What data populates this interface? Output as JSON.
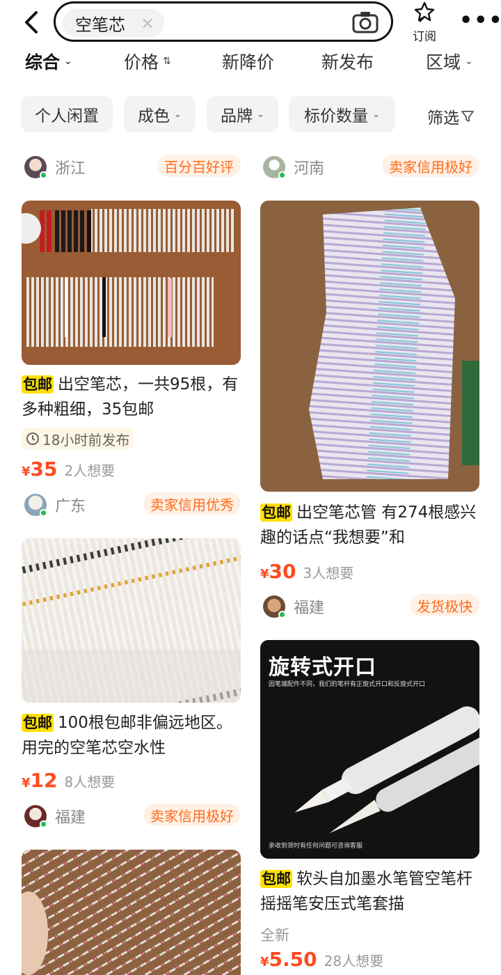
{
  "search": {
    "query": "空笔芯",
    "clear_glyph": "×"
  },
  "header": {
    "subscribe_label": "订阅"
  },
  "sort": [
    {
      "label": "综合",
      "caret": "⌄"
    },
    {
      "label": "价格",
      "caret": "⇅"
    },
    {
      "label": "新降价"
    },
    {
      "label": "新发布"
    },
    {
      "label": "区域",
      "caret": "⌄"
    }
  ],
  "filters": [
    {
      "label": "个人闲置"
    },
    {
      "label": "成色",
      "caret": "⌄"
    },
    {
      "label": "品牌",
      "caret": "⌄"
    },
    {
      "label": "标价数量",
      "caret": "⌄"
    }
  ],
  "filter_button": {
    "label": "筛选",
    "icon": "funnel-icon"
  },
  "items": [
    {
      "region": "浙江",
      "badge": "百分百好评",
      "tag": "包邮",
      "title": "出空笔芯，一共95根，有多种粗细，35包邮",
      "posted": "18小时前发布",
      "currency": "¥",
      "price": "35",
      "want": "2人想要"
    },
    {
      "region": "河南",
      "badge": "卖家信用极好",
      "tag": "包邮",
      "title": "出空笔芯管 有274根感兴趣的话点“我想要”和",
      "currency": "¥",
      "price": "30",
      "want": "3人想要"
    },
    {
      "region": "广东",
      "badge": "卖家信用优秀",
      "tag": "包邮",
      "title": "100根包邮非偏远地区。用完的空笔芯空水性",
      "currency": "¥",
      "price": "12",
      "want": "8人想要"
    },
    {
      "region": "福建",
      "badge": "发货极快",
      "image_headline": "旋转式开口",
      "image_sub": "因笔端配件不同，我们的笔杆有正旋式开口和反旋式开口",
      "image_footer": "亲收到货时有任何问题可咨询客服",
      "tag": "包邮",
      "title": "软头自加墨水笔管空笔杆摇摇笔安压式笔套描",
      "condition": "全新",
      "currency": "¥",
      "price": "5.50",
      "want": "28人想要"
    },
    {
      "region": "福建",
      "badge": "卖家信用极好"
    }
  ],
  "colors": {
    "accent": "#ff4a1f",
    "badge_text": "#ff6a1a",
    "tag_bg": "#ffe000",
    "online": "#1fbf52"
  }
}
